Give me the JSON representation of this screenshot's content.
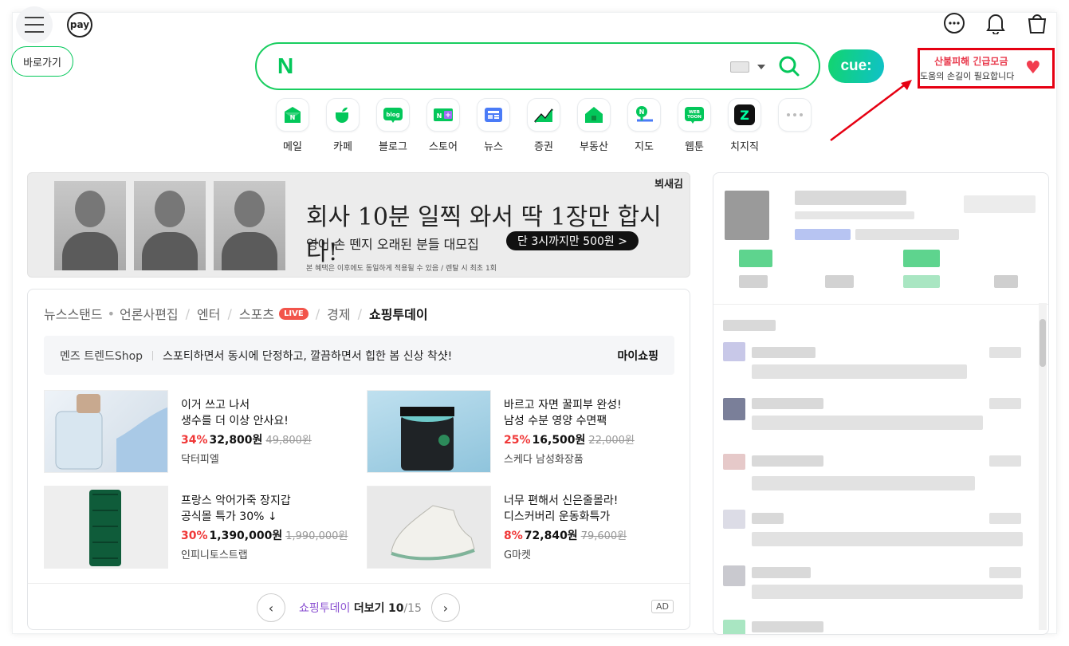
{
  "header": {
    "menu_tip": "바로가기",
    "pay_label": "pay",
    "icons": [
      "more-dots-icon",
      "bell-icon",
      "shopping-bag-icon"
    ]
  },
  "search": {
    "logo": "N",
    "value": "",
    "placeholder": "",
    "cue_label": "cue:"
  },
  "promo": {
    "title": "산불피해 긴급모금",
    "subtitle": "도움의 손길이 필요합니다",
    "border_color": "#e60012"
  },
  "services": [
    {
      "label": "메일",
      "icon": "mail-icon",
      "color": "#03c75a"
    },
    {
      "label": "카페",
      "icon": "cafe-icon",
      "color": "#03c75a"
    },
    {
      "label": "블로그",
      "icon": "blog-icon",
      "color": "#03c75a"
    },
    {
      "label": "스토어",
      "icon": "store-icon",
      "color": "#03c75a"
    },
    {
      "label": "뉴스",
      "icon": "news-icon",
      "color": "#4a7bf7"
    },
    {
      "label": "증권",
      "icon": "stock-icon",
      "color": "#03c75a"
    },
    {
      "label": "부동산",
      "icon": "realestate-icon",
      "color": "#03c75a"
    },
    {
      "label": "지도",
      "icon": "map-icon",
      "color": "#03c75a"
    },
    {
      "label": "웹툰",
      "icon": "webtoon-icon",
      "color": "#03c75a"
    },
    {
      "label": "치지직",
      "icon": "chzzk-icon",
      "color": "#111111"
    },
    {
      "label": "",
      "icon": "more-services-icon",
      "color": "#bbbbbb"
    }
  ],
  "banner": {
    "brand": "뵈새김",
    "headline": "회사 10분 일찍 와서 딱 1장만 합시다!",
    "subline": "영어 손 뗀지 오래된 분들 대모집",
    "cta": "단 3시까지만 500원 >",
    "fine_print": "본 혜택은 이후에도 동일하게 적용될 수 있음 / 렌탈 시 최초 1회"
  },
  "news_tabs": {
    "items": [
      "뉴스스탠드",
      "언론사편집",
      "엔터",
      "스포츠",
      "경제",
      "쇼핑투데이"
    ],
    "live_badge": "LIVE"
  },
  "trend": {
    "category": "멘즈 트렌드Shop",
    "text": "스포티하면서 동시에 단정하고, 깔끔하면서 힙한 봄 신상 착샷!",
    "my_shopping": "마이쇼핑"
  },
  "products": [
    {
      "line1": "이거 쓰고 나서",
      "line2": "생수를 더 이상 안사요!",
      "pct": "34%",
      "price": "32,800원",
      "old": "49,800원",
      "shop": "닥터피엘"
    },
    {
      "line1": "바르고 자면 꿀피부 완성!",
      "line2": "남성 수분 영양 수면팩",
      "pct": "25%",
      "price": "16,500원",
      "old": "22,000원",
      "shop": "스케다 남성화장품"
    },
    {
      "line1": "프랑스 악어가죽 장지갑",
      "line2": "공식몰 특가 30% ↓",
      "pct": "30%",
      "price": "1,390,000원",
      "old": "1,990,000원",
      "shop": "인피니토스트랩"
    },
    {
      "line1": "너무 편해서 신은줄몰라!",
      "line2": "디스커버리 운동화특가",
      "pct": "8%",
      "price": "72,840원",
      "old": "79,600원",
      "shop": "G마켓"
    }
  ],
  "pager": {
    "link_label": "쇼핑투데이",
    "more_label": "더보기",
    "current": "10",
    "total": "/15",
    "ad_label": "AD"
  }
}
